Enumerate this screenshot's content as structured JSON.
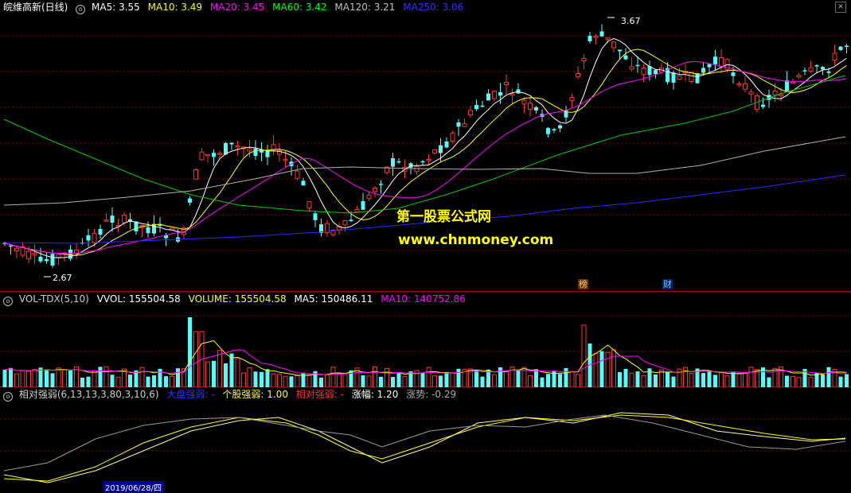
{
  "main": {
    "title": "皖维高新(日线)",
    "ma": [
      {
        "label": "MA5: 3.55",
        "color": "#ffffff"
      },
      {
        "label": "MA10: 3.49",
        "color": "#ffff00"
      },
      {
        "label": "MA20: 3.45",
        "color": "#ff00ff"
      },
      {
        "label": "MA60: 3.42",
        "color": "#00ff00"
      },
      {
        "label": "MA120: 3.21",
        "color": "#c0c0c0"
      },
      {
        "label": "MA250: 3.06",
        "color": "#3030ff"
      }
    ],
    "high_label": "3.67",
    "low_label": "2.67",
    "marker_1": "榜",
    "marker_2": "财"
  },
  "watermark": {
    "line1": "第一股票公式网",
    "line2": "www.chnmoney.com"
  },
  "volume": {
    "title": "VOL-TDX(5,10)",
    "vvol": "VVOL: 155504.58",
    "volume": "VOLUME: 155504.58",
    "ma5": "MA5: 150486.11",
    "ma10": "MA10: 140752.86"
  },
  "relative_strength": {
    "title": "相对强弱(6,13,13,3,80,3,10,6)",
    "dapan": "大盘强弱: -",
    "gegu": "个股强弱: 1.00",
    "xiangdui": "相对强弱: -",
    "zhangfu": "涨幅: 1.20",
    "zhangshi": "涨势: -0.29"
  },
  "axis": {
    "selected_date": "2019/06/28/四"
  },
  "colors": {
    "up": "#ff3232",
    "down": "#54fcfc",
    "grid": "#800000",
    "border": "#a00000"
  }
}
